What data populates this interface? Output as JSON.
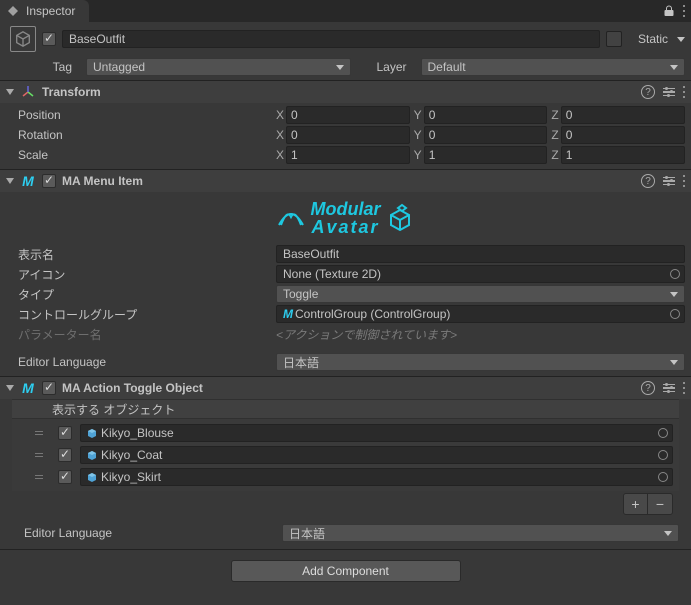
{
  "tabBar": {
    "title": "Inspector"
  },
  "header": {
    "name": "BaseOutfit",
    "enabled": true,
    "staticLabel": "Static",
    "tagLabel": "Tag",
    "tagValue": "Untagged",
    "layerLabel": "Layer",
    "layerValue": "Default"
  },
  "transform": {
    "title": "Transform",
    "rows": {
      "Position": {
        "x": "0",
        "y": "0",
        "z": "0"
      },
      "Rotation": {
        "x": "0",
        "y": "0",
        "z": "0"
      },
      "Scale": {
        "x": "1",
        "y": "1",
        "z": "1"
      }
    },
    "labels": {
      "position": "Position",
      "rotation": "Rotation",
      "scale": "Scale",
      "x": "X",
      "y": "Y",
      "z": "Z"
    }
  },
  "maMenuItem": {
    "title": "MA Menu Item",
    "enabled": true,
    "props": {
      "displayName": {
        "label": "表示名",
        "value": "BaseOutfit"
      },
      "icon": {
        "label": "アイコン",
        "value": "None (Texture 2D)"
      },
      "type": {
        "label": "タイプ",
        "value": "Toggle"
      },
      "controlGroup": {
        "label": "コントロールグループ",
        "value": "ControlGroup (ControlGroup)"
      },
      "paramName": {
        "label": "パラメーター名",
        "placeholder": "<アクションで制御されています>"
      }
    },
    "editorLangLabel": "Editor Language",
    "editorLangValue": "日本語"
  },
  "maActionToggle": {
    "title": "MA Action Toggle Object",
    "enabled": true,
    "subheader": "表示する オブジェクト",
    "items": [
      {
        "checked": true,
        "name": "Kikyo_Blouse"
      },
      {
        "checked": true,
        "name": "Kikyo_Coat"
      },
      {
        "checked": true,
        "name": "Kikyo_Skirt"
      }
    ],
    "editorLangLabel": "Editor Language",
    "editorLangValue": "日本語"
  },
  "footer": {
    "addComponent": "Add Component"
  }
}
